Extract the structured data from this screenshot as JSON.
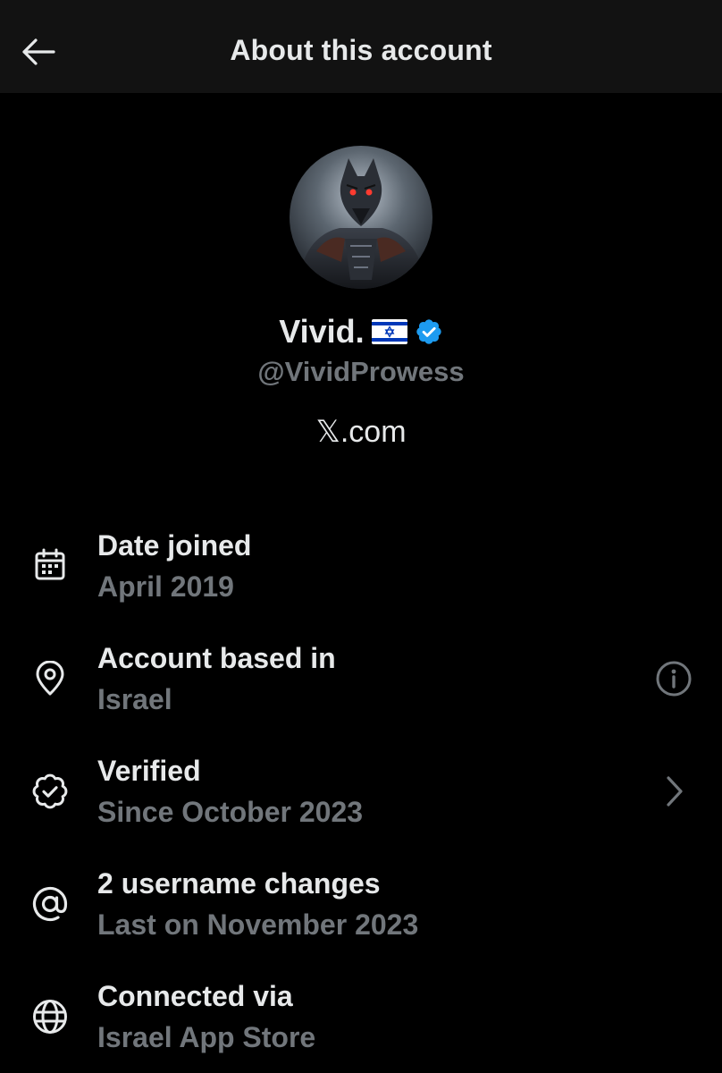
{
  "header": {
    "title": "About this account",
    "back_icon": "arrow-left-icon"
  },
  "profile": {
    "display_name": "Vivid.",
    "flag_icon": "israel-flag-icon",
    "verified_icon": "verified-badge-icon",
    "verified_color": "#1d9bf0",
    "handle": "@VividProwess",
    "website": "𝕏.com"
  },
  "rows": [
    {
      "icon": "calendar-icon",
      "title": "Date joined",
      "subtitle": "April 2019"
    },
    {
      "icon": "location-pin-icon",
      "title": "Account based in",
      "subtitle": "Israel",
      "action_icon": "info-icon"
    },
    {
      "icon": "verified-check-icon",
      "title": "Verified",
      "subtitle": "Since October 2023",
      "action_icon": "chevron-right-icon"
    },
    {
      "icon": "at-sign-icon",
      "title": "2 username changes",
      "subtitle": "Last on November 2023"
    },
    {
      "icon": "globe-icon",
      "title": "Connected via",
      "subtitle": "Israel App Store"
    }
  ],
  "colors": {
    "background": "#000000",
    "header_background": "#121212",
    "primary_text": "#e7e9ea",
    "secondary_text": "#71767b"
  }
}
